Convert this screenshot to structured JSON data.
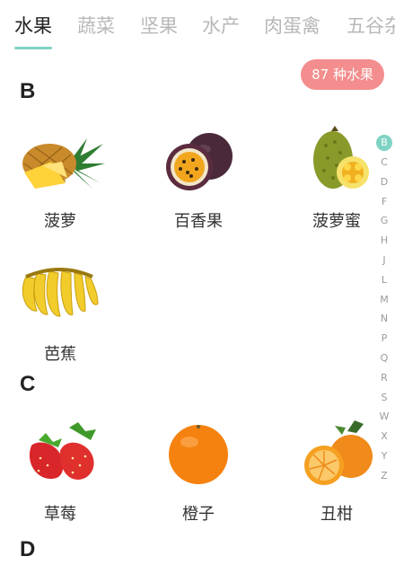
{
  "tabs": [
    "水果",
    "蔬菜",
    "坚果",
    "水产",
    "肉蛋禽",
    "五谷杂"
  ],
  "active_tab": "水果",
  "badge": "87 种水果",
  "sections": [
    {
      "letter": "B",
      "items": [
        "菠萝",
        "百香果",
        "菠萝蜜",
        "芭蕉"
      ]
    },
    {
      "letter": "C",
      "items": [
        "草莓",
        "橙子",
        "丑柑"
      ]
    },
    {
      "letter": "D",
      "items": []
    }
  ],
  "alphabet": [
    "B",
    "C",
    "D",
    "F",
    "G",
    "H",
    "J",
    "L",
    "M",
    "N",
    "P",
    "Q",
    "R",
    "S",
    "W",
    "X",
    "Y",
    "Z"
  ],
  "alphabet_active": "B",
  "colors": {
    "accent": "#7fd3c3",
    "badge": "#f48d8d"
  }
}
